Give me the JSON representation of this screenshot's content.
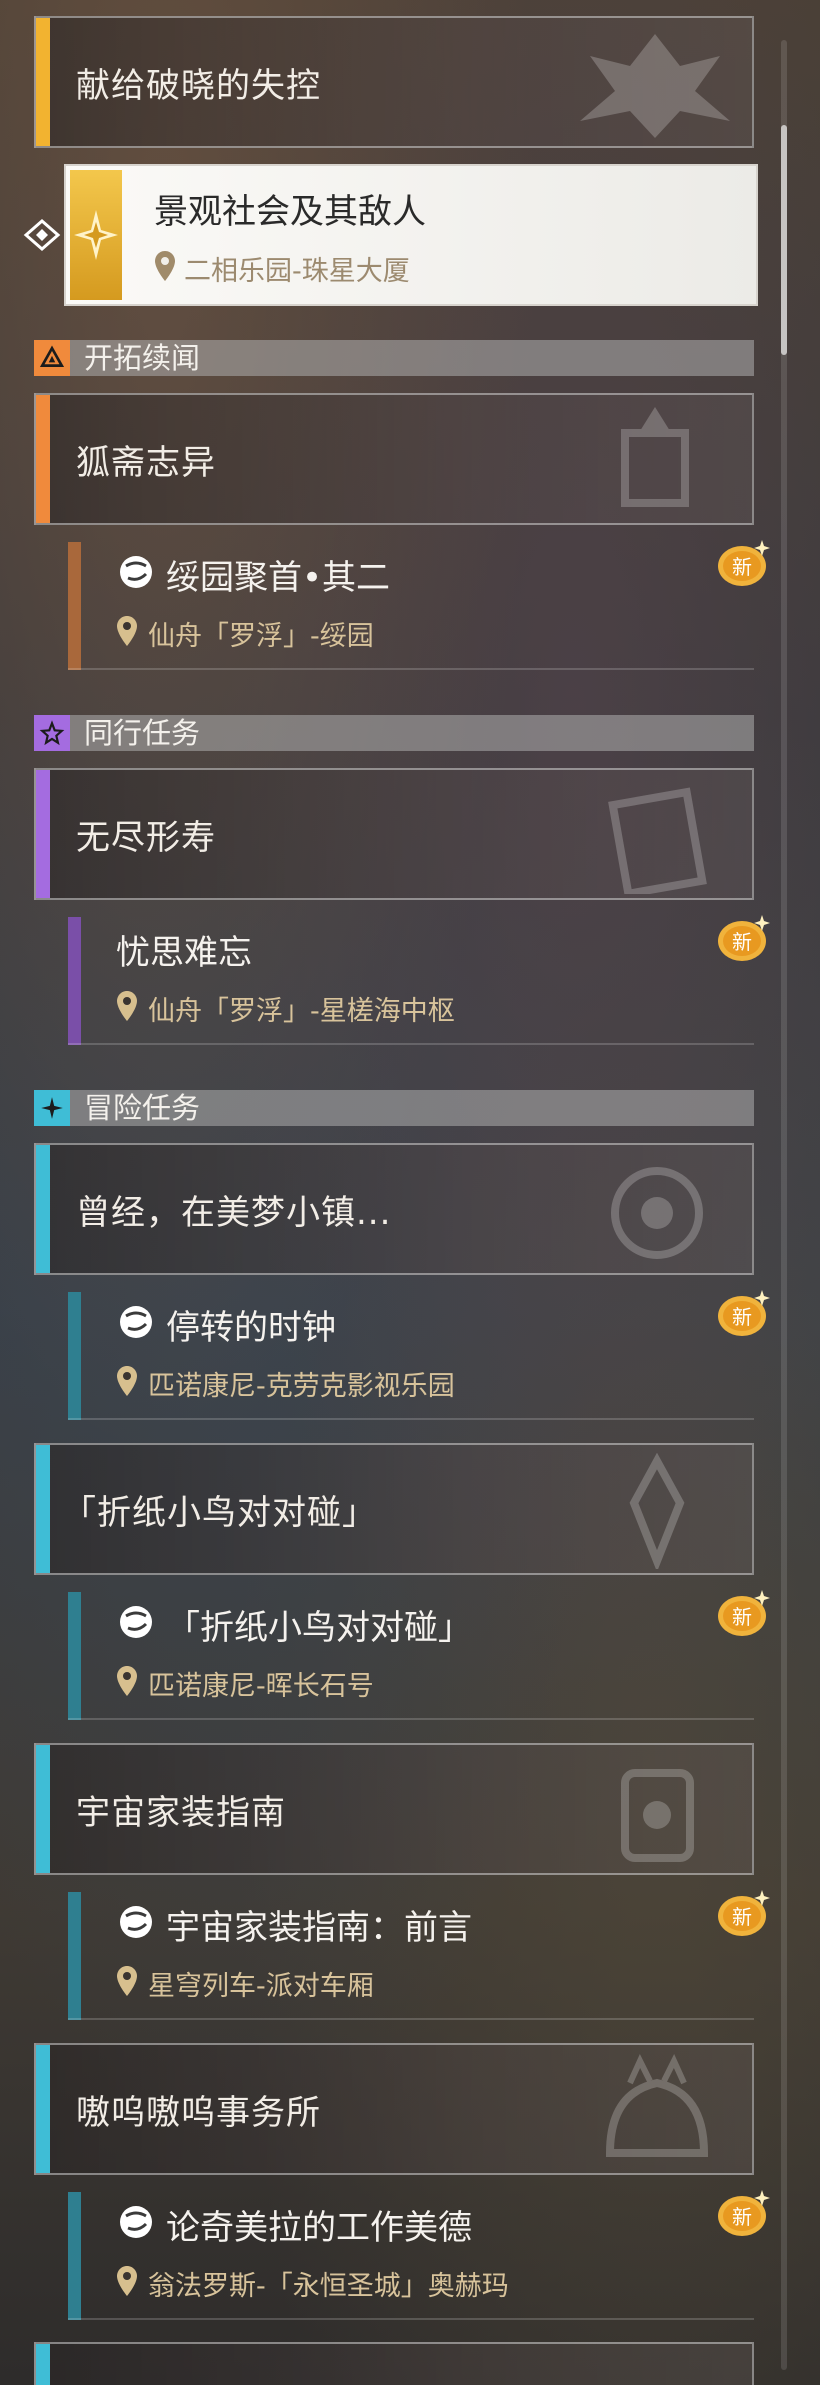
{
  "main_quest": {
    "title": "献给破晓的失控"
  },
  "active_quest": {
    "title": "景观社会及其敌人",
    "location": "二相乐园-珠星大厦"
  },
  "sections": {
    "trailblaze": {
      "label": "开拓续闻",
      "color": "#f08a3c"
    },
    "companion": {
      "label": "同行任务",
      "color": "#a46ce0"
    },
    "adventure": {
      "label": "冒险任务",
      "color": "#3fbdd6"
    }
  },
  "quests": {
    "fox": {
      "title": "狐斋志异"
    },
    "fox_sub": {
      "title": "绥园聚首•其二",
      "location": "仙舟「罗浮」-绥园"
    },
    "endless": {
      "title": "无尽形寿"
    },
    "endless_sub": {
      "title": "忧思难忘",
      "location": "仙舟「罗浮」-星槎海中枢"
    },
    "dream": {
      "title": "曾经，在美梦小镇..."
    },
    "dream_sub": {
      "title": "停转的时钟",
      "location": "匹诺康尼-克劳克影视乐园"
    },
    "origami": {
      "title": "「折纸小鸟对对碰」"
    },
    "origami_sub": {
      "title": "「折纸小鸟对对碰」",
      "location": "匹诺康尼-晖长石号"
    },
    "cosmic": {
      "title": "宇宙家装指南"
    },
    "cosmic_sub": {
      "title": "宇宙家装指南：前言",
      "location": "星穹列车-派对车厢"
    },
    "awoo": {
      "title": "嗷呜嗷呜事务所"
    },
    "awoo_sub": {
      "title": "论奇美拉的工作美德",
      "location": "翁法罗斯-「永恒圣城」奥赫玛"
    }
  },
  "badge": {
    "new_label": "新"
  }
}
